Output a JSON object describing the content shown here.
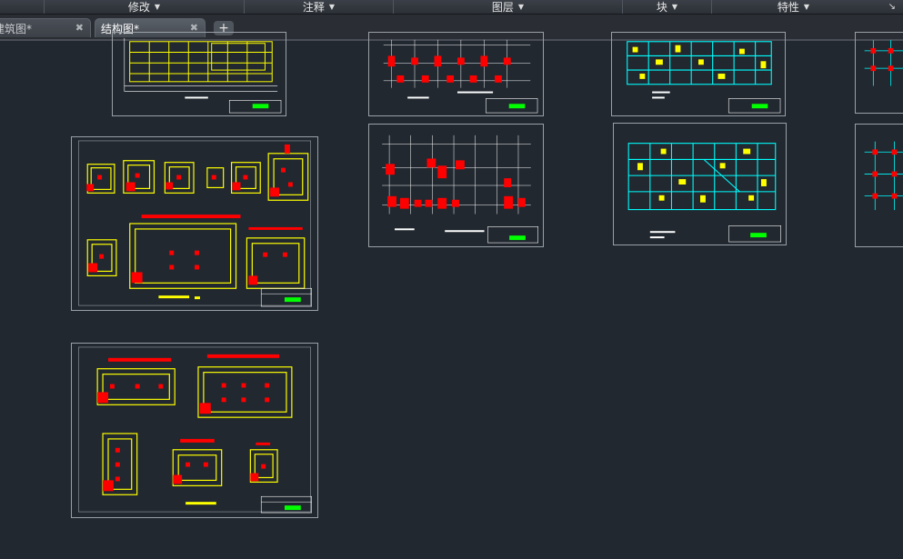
{
  "ribbon": {
    "panels": [
      {
        "label": "修改"
      },
      {
        "label": "注释"
      },
      {
        "label": "图层"
      },
      {
        "label": "块"
      },
      {
        "label": "特性"
      }
    ],
    "corner_icon": "dialog-launcher-icon"
  },
  "tabs": [
    {
      "label": "建筑图*",
      "active": false
    },
    {
      "label": "结构图*",
      "active": true
    }
  ],
  "new_tab_icon": "plus-icon",
  "colors": {
    "background": "#212830",
    "sheet_border": "#9aa0a6",
    "yellow": "#ffff00",
    "red": "#ff0000",
    "cyan": "#00ffff",
    "green": "#00ff00",
    "white": "#ffffff"
  }
}
